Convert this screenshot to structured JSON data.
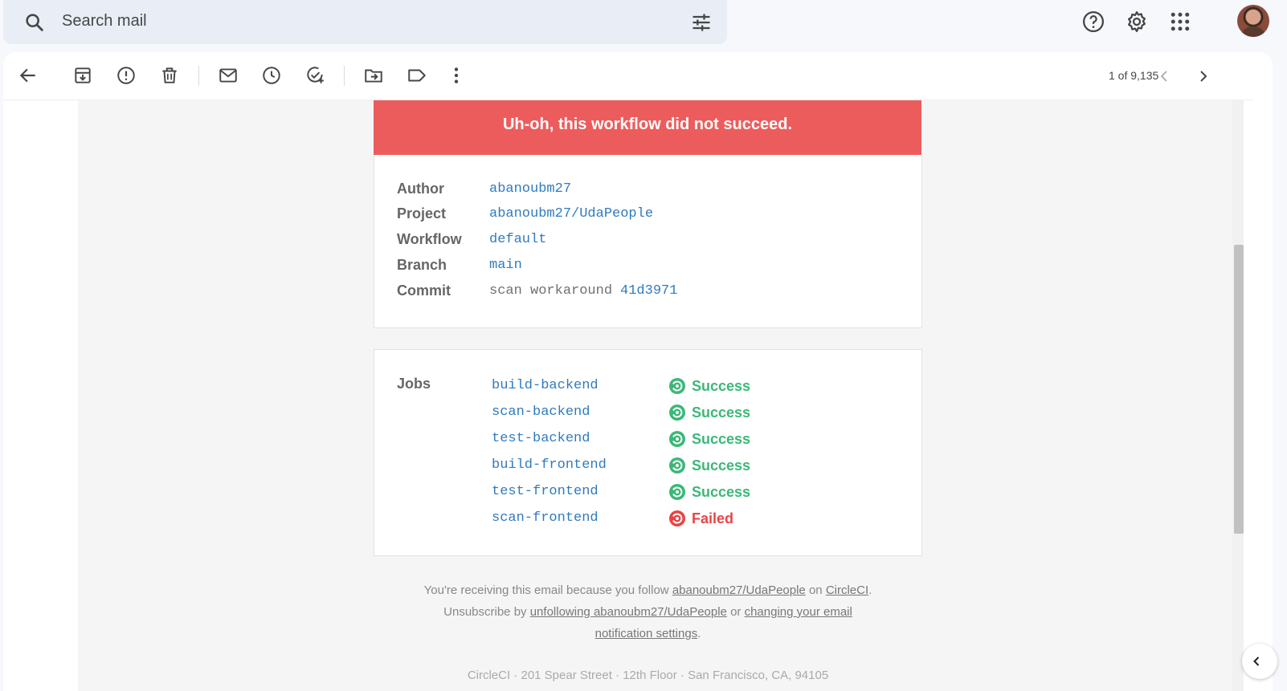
{
  "search": {
    "placeholder": "Search mail"
  },
  "toolbar": {
    "pager": "1 of 9,135"
  },
  "email": {
    "banner": "Uh-oh, this workflow did not succeed.",
    "details": [
      {
        "label": "Author",
        "value": "abanoubm27"
      },
      {
        "label": "Project",
        "value": "abanoubm27/UdaPeople"
      },
      {
        "label": "Workflow",
        "value": "default"
      },
      {
        "label": "Branch",
        "value": "main"
      },
      {
        "label": "Commit",
        "message": "scan workaround",
        "value": "41d3971"
      }
    ],
    "jobs_label": "Jobs",
    "jobs": [
      {
        "name": "build-backend",
        "status": "Success"
      },
      {
        "name": "scan-backend",
        "status": "Success"
      },
      {
        "name": "test-backend",
        "status": "Success"
      },
      {
        "name": "build-frontend",
        "status": "Success"
      },
      {
        "name": "test-frontend",
        "status": "Success"
      },
      {
        "name": "scan-frontend",
        "status": "Failed"
      }
    ],
    "footer": {
      "line1_pre": "You're receiving this email because you follow ",
      "project_link": "abanoubm27/UdaPeople",
      "line1_mid": " on ",
      "circleci_link": "CircleCI",
      "line1_post": ".",
      "line2_pre": "Unsubscribe by ",
      "unfollow_link": "unfollowing abanoubm27/UdaPeople",
      "line2_mid": " or ",
      "settings_link": "changing your email notification settings",
      "line2_post": "."
    },
    "address": "CircleCI · 201 Spear Street · 12th Floor · San Francisco, CA, 94105"
  },
  "colors": {
    "failed": "#ed5c5c",
    "success": "#3bb878",
    "link": "#2f7bbf"
  }
}
